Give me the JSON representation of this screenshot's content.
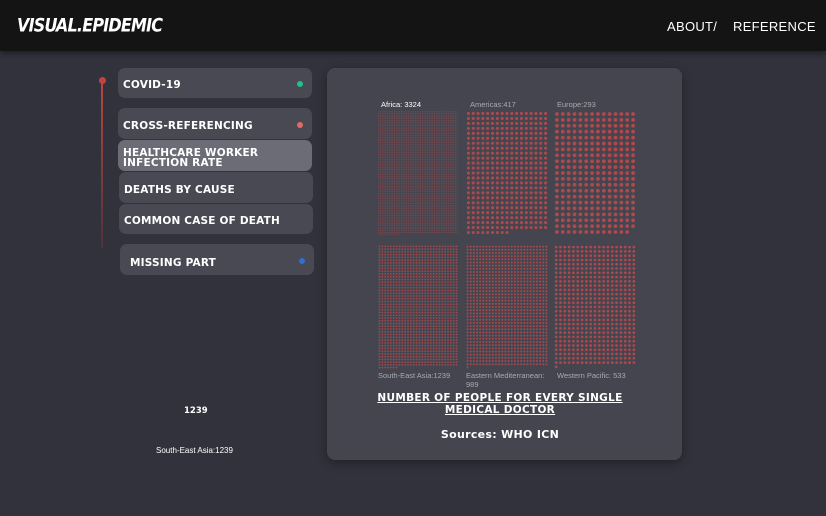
{
  "header": {
    "logo": "VISUAL.EPIDEMIC",
    "nav": [
      "ABOUT/",
      "REFERENCE"
    ]
  },
  "sidebar": {
    "items": [
      {
        "label": "COVID-19",
        "dot_color": "#22c08a"
      },
      {
        "label": "CROSS-REFERENCING",
        "dot_color": "#e36a64"
      },
      {
        "label": "HEALTHCARE WORKER INFECTION RATE",
        "active": true
      },
      {
        "label": "DEATHS BY CAUSE"
      },
      {
        "label": "COMMON CASE OF DEATH"
      },
      {
        "label": "MISSING PART",
        "dot_color": "#2e6fd1"
      }
    ],
    "timeline_color": "#c0453f"
  },
  "hover_info": {
    "value": "1239",
    "caption": "South-East Asia:1239"
  },
  "chart_data": {
    "type": "unit-dot-grid",
    "title": "NUMBER OF PEOPLE FOR EVERY SINGLE MEDICAL DOCTOR",
    "source": "Sources: WHO ICN",
    "dot_color": "#b34a4e",
    "regions": [
      {
        "name": "Africa",
        "value": 3324,
        "label": "Africa: 3324",
        "highlighted": true
      },
      {
        "name": "Americas",
        "value": 417,
        "label": "Americas:417"
      },
      {
        "name": "Europe",
        "value": 293,
        "label": "Europe:293"
      },
      {
        "name": "South-East Asia",
        "value": 1239,
        "label": "South-East Asia:1239"
      },
      {
        "name": "Eastern Mediterranean",
        "value": 989,
        "label": "Eastern Mediterranean: 989"
      },
      {
        "name": "Western Pacific",
        "value": 533,
        "label": "Western Pacific: 533"
      }
    ]
  }
}
